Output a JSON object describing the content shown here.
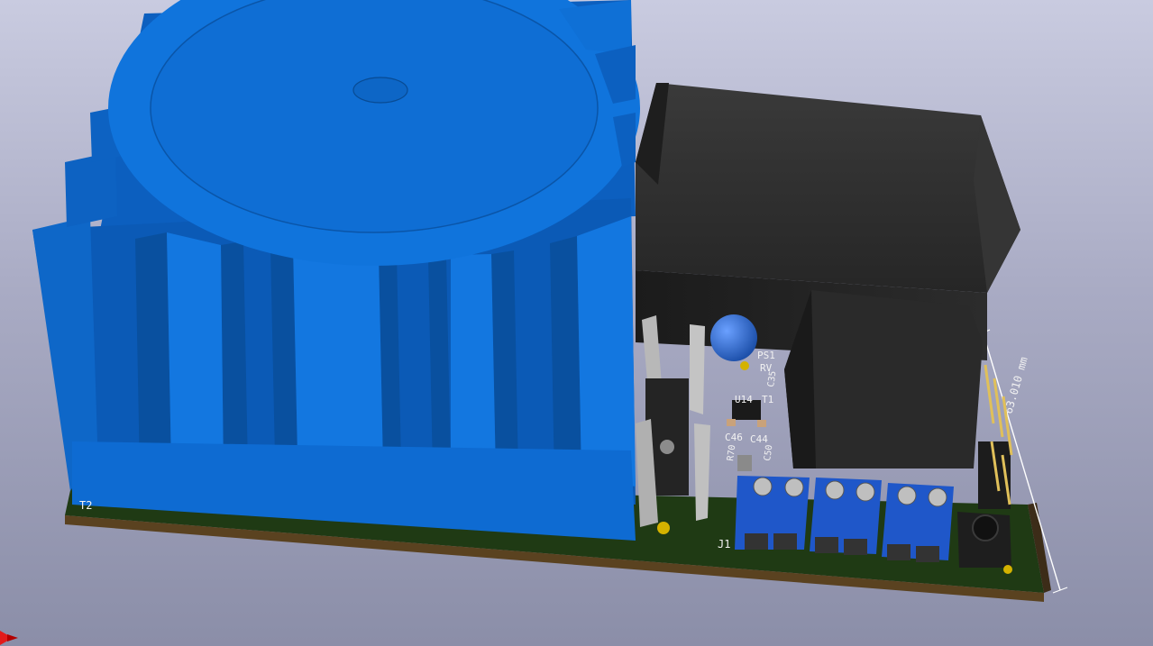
{
  "app": {
    "title": "",
    "view": "3D Viewer"
  },
  "pcb": {
    "board_color": "#1f3a14",
    "edge_color": "#5a4220",
    "silkscreen_color": "#f2f2f2",
    "heatsink_color": "#0f6ad0",
    "relay_color": "#2a2a2a",
    "terminal_color": "#1f57c9",
    "labels": {
      "transformer": "T2",
      "connector": "J1",
      "power_supply": "PS1",
      "varistor": "RV",
      "ic": "U14",
      "transistor": "T1",
      "cap_a": "C46",
      "cap_b": "C44",
      "cap_c": "C35",
      "cap_d": "C50",
      "resistor": "R70"
    },
    "dimension_label": "63.010 mm"
  },
  "axes_icon": "axis-origin-icon"
}
